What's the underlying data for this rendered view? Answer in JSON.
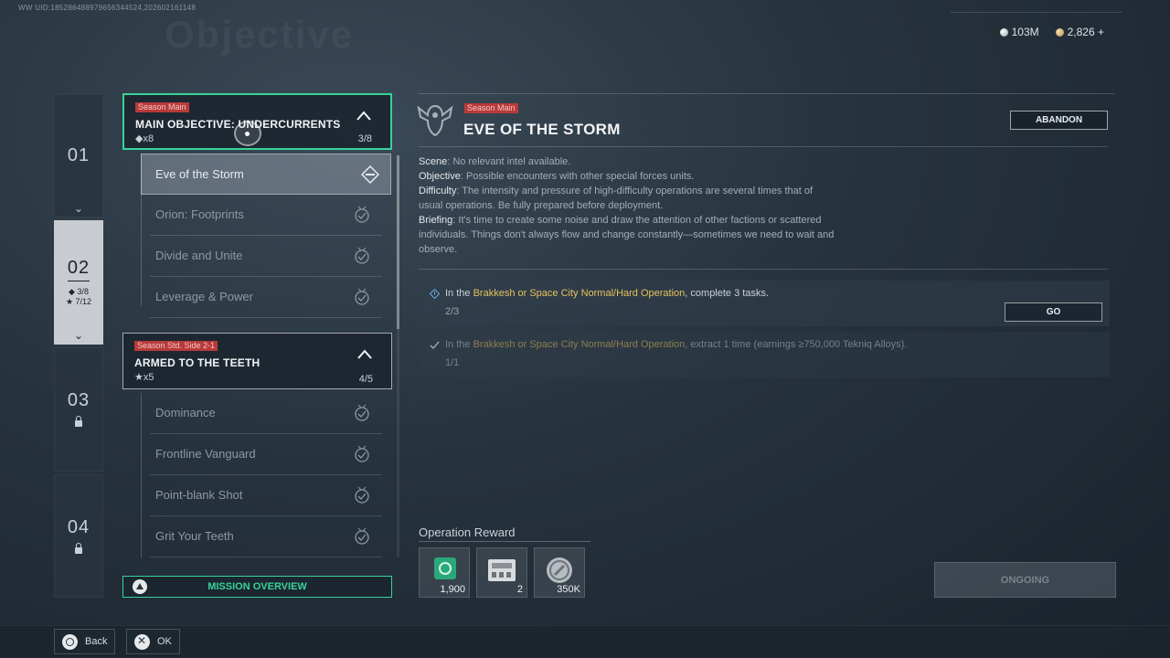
{
  "uid": "WW UID:185286488979656344524,202602161148",
  "bg_title": "Objective",
  "currency": {
    "silver": "103M",
    "gold": "2,826 +"
  },
  "chapters": [
    {
      "num": "01",
      "locked": false
    },
    {
      "num": "02",
      "diamond": "3/8",
      "star": "7/12",
      "active": true
    },
    {
      "num": "03",
      "locked": true
    },
    {
      "num": "04",
      "locked": true
    }
  ],
  "missions": [
    {
      "tag": "Season Main",
      "title": "MAIN OBJECTIVE: UNDERCURRENTS",
      "reward": "x8",
      "progress": "3/8",
      "tasks": [
        "Eve of the Storm",
        "Orion: Footprints",
        "Divide and Unite",
        "Leverage & Power"
      ]
    },
    {
      "tag": "Season Std. Side 2-1",
      "title": "ARMED TO THE TEETH",
      "reward": "x5",
      "progress": "4/5",
      "tasks": [
        "Dominance",
        "Frontline Vanguard",
        "Point-blank Shot",
        "Grit Your Teeth"
      ]
    }
  ],
  "overview_label": "MISSION OVERVIEW",
  "detail": {
    "tag": "Season Main",
    "title": "EVE OF THE STORM",
    "abandon_label": "ABANDON",
    "scene_label": "Scene",
    "scene": ": No relevant intel available.",
    "objective_label": "Objective",
    "objective": ": Possible encounters with other special forces units.",
    "difficulty_label": "Difficulty",
    "difficulty": ": The intensity and pressure of high-difficulty operations are several times that of usual operations. Be fully prepared before deployment.",
    "briefing_label": "Briefing",
    "briefing": ": It's time to create some noise and draw the attention of other factions or scattered individuals. Things don't always flow and change constantly—sometimes we need to wait and observe."
  },
  "objectives": [
    {
      "pre": "In the ",
      "hl": "Brakkesh or Space City Normal/Hard Operation",
      "post": ", complete 3 tasks.",
      "count": "2/3",
      "done": false
    },
    {
      "pre": "In the ",
      "hl": "Brakkesh or Space City Normal/Hard Operation",
      "post": ", extract 1 time (earnings ≥750,000 Tekniq Alloys).",
      "count": "1/1",
      "done": true
    }
  ],
  "go_label": "GO",
  "reward_label": "Operation Reward",
  "rewards": [
    {
      "qty": "1,900"
    },
    {
      "qty": "2"
    },
    {
      "qty": "350K"
    }
  ],
  "ongoing_label": "ONGOING",
  "footer": {
    "back": "Back",
    "ok": "OK"
  },
  "colors": {
    "accent": "#38d39a",
    "tag_red": "#b83a3a",
    "highlight": "#e7c25c"
  }
}
